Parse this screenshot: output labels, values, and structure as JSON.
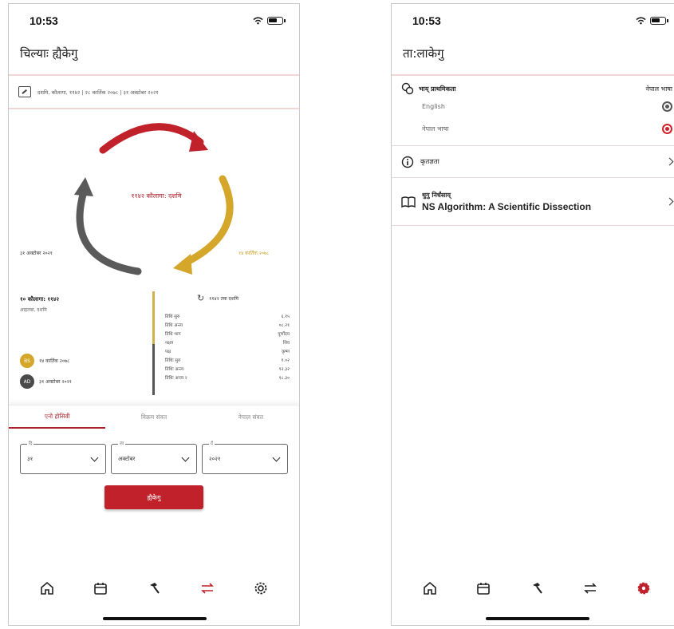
{
  "left_screen": {
    "status_time": "10:53",
    "title": "चिल्याः ह्यैकेगु",
    "date_strip": "दशमि, कौलागा, ११४२ | २८ कार्तिक २०७८ | ३१ अक्टोबर २०२१",
    "cycle": {
      "center_label": "११४२ कौलागा: दशमि",
      "left_label": "३१ अक्टोबर २०२१",
      "right_label": "१४ कार्तिक २०७८",
      "colors": {
        "red": "#c0212a",
        "gold": "#d4a62a",
        "gray": "#5a5a5a"
      }
    },
    "detail": {
      "title": "१० कौलागा: ११४२",
      "subtitle": "आइतबा, दशमि",
      "legend": [
        {
          "badge": "BS",
          "label": "१४ कार्तिक २०७८",
          "color": "#d4a62a"
        },
        {
          "badge": "AD",
          "label": "३१ अक्टोबर २०२१",
          "color": "#4a4a4a"
        }
      ],
      "refresh_label": "११४२ तक दशमि",
      "rows": [
        {
          "k": "तिथि सुरु",
          "v": "६.१५"
        },
        {
          "k": "तिथि अन्त्य",
          "v": "०८.२१"
        },
        {
          "k": "तिथि भाग",
          "v": "पूर्णोदय"
        },
        {
          "k": "नक्षत्र",
          "v": "शिव"
        },
        {
          "k": "पक्ष",
          "v": "कृष्ण"
        },
        {
          "k": "तिथिः सुरु",
          "v": "१.०२"
        },
        {
          "k": "तिथिः अन्त्य",
          "v": "१२.३२"
        },
        {
          "k": "तिथिः अन्त्य २",
          "v": "१८.३०"
        }
      ]
    },
    "tabs": [
      "एनो होसिवी",
      "विक्रम संवत",
      "नेपाल संवत"
    ],
    "selects": [
      {
        "label": "दि",
        "value": "३१"
      },
      {
        "label": "ला",
        "value": "अक्टोबर"
      },
      {
        "label": "दँ",
        "value": "२०२१"
      }
    ],
    "convert_button": "ह्यैकेगु"
  },
  "right_screen": {
    "status_time": "10:53",
    "title": "ता:लाकेगु",
    "language": {
      "heading": "भाय् प्राथमिकता",
      "current": "नेपाल भाषा",
      "options": [
        {
          "label": "English",
          "selected": false
        },
        {
          "label": "नेपाल भाषा",
          "selected": true
        }
      ]
    },
    "about_label": "कृतज्ञता",
    "algorithm": {
      "title": "थुगु निर्धंसाय्",
      "subtitle": "NS Algorithm: A Scientific Dissection"
    }
  },
  "tabbar_icons": [
    "home-icon",
    "calendar-icon",
    "hammer-icon",
    "swap-icon",
    "gear-icon"
  ],
  "accent_color": "#c0212a"
}
